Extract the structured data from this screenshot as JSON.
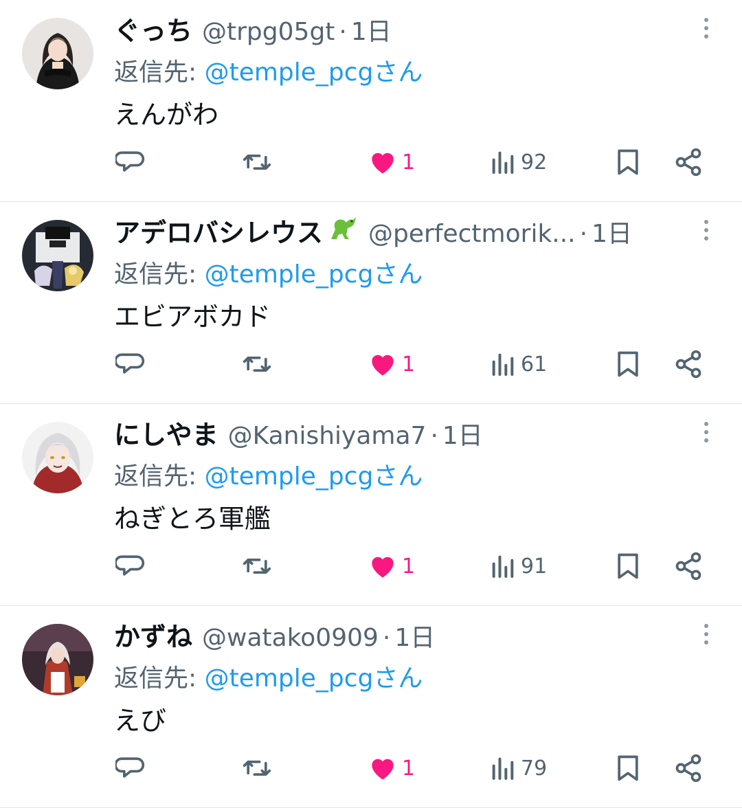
{
  "colors": {
    "accent": "#1d9bf0",
    "like": "#f91880",
    "muted": "#536471"
  },
  "icons": {
    "reply": "speech-bubble-icon",
    "retweet": "retweet-arrows-icon",
    "like": "heart-icon",
    "views": "bar-chart-icon",
    "bookmark": "bookmark-icon",
    "share": "share-icon",
    "more": "vertical-dots-icon"
  },
  "tweets": [
    {
      "name": "ぐっち",
      "handle": "@trpg05gt",
      "dot": "·",
      "time": "1日",
      "reply_label": "返信先:",
      "reply_to": "@temple_pcgさん",
      "text": "えんがわ",
      "likes": "1",
      "views": "92"
    },
    {
      "name": "アデロバシレウス",
      "name_emoji": "dinosaur",
      "handle": "@perfectmorik...",
      "dot": "·",
      "time": "1日",
      "reply_label": "返信先:",
      "reply_to": "@temple_pcgさん",
      "text": "エビアボカド",
      "likes": "1",
      "views": "61"
    },
    {
      "name": "にしやま",
      "handle": "@Kanishiyama7",
      "dot": "·",
      "time": "1日",
      "reply_label": "返信先:",
      "reply_to": "@temple_pcgさん",
      "text": "ねぎとろ軍艦",
      "likes": "1",
      "views": "91"
    },
    {
      "name": "かずね",
      "handle": "@watako0909",
      "dot": "·",
      "time": "1日",
      "reply_label": "返信先:",
      "reply_to": "@temple_pcgさん",
      "text": "えび",
      "likes": "1",
      "views": "79"
    }
  ]
}
